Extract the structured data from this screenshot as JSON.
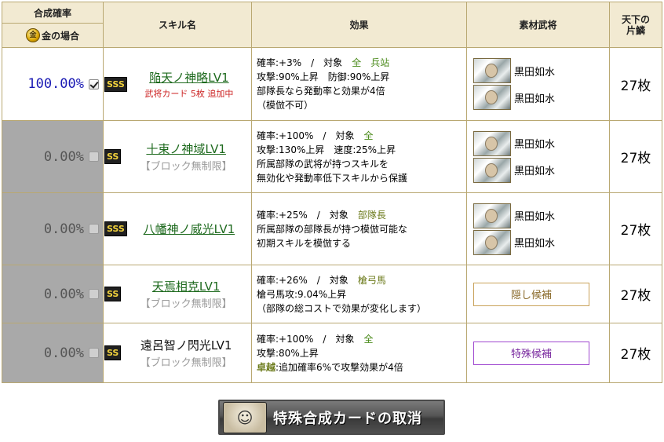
{
  "header": {
    "rate_title": "合成確率",
    "gold_label": "金の場合",
    "coin_icon_text": "金",
    "skill_name": "スキル名",
    "effect": "効果",
    "material": "素材武将",
    "tenka_line1": "天下の",
    "tenka_line2": "片鱗"
  },
  "rows": [
    {
      "rate": "100.00%",
      "checked": true,
      "rank": "SSS",
      "skill": "陥天ノ神略LV1",
      "sub": "武将カード 5枚 追加中",
      "effect": {
        "l1_prefix": "確率:+3%　/　対象　",
        "l1_target": "全　兵站",
        "l2": "攻撃:90%上昇　防御:90%上昇",
        "l3": "部隊長なら発動率と効果が4倍",
        "l4": "（模倣不可）"
      },
      "materials": [
        "黒田如水",
        "黒田如水"
      ],
      "tenka": "27枚"
    },
    {
      "rate": "0.00%",
      "checked": false,
      "rank": "SS",
      "skill": "十束ノ神域LV1",
      "sub": "【ブロック無制限】",
      "effect": {
        "l1_prefix": "確率:+100%　/　対象　",
        "l1_target": "全",
        "l2": "攻撃:130%上昇　速度:25%上昇",
        "l3": "所属部隊の武将が持つスキルを",
        "l4": "無効化や発動率低下スキルから保護"
      },
      "materials": [
        "黒田如水",
        "黒田如水"
      ],
      "tenka": "27枚"
    },
    {
      "rate": "0.00%",
      "checked": false,
      "rank": "SSS",
      "skill": "八幡神ノ威光LV1",
      "sub": "",
      "effect": {
        "l1_prefix": "確率:+25%　/　対象　",
        "l1_target": "部隊長",
        "l2": "所属部隊の部隊長が持つ模倣可能な",
        "l3": "初期スキルを模倣する"
      },
      "materials": [
        "黒田如水",
        "黒田如水"
      ],
      "tenka": "27枚"
    },
    {
      "rate": "0.00%",
      "checked": false,
      "rank": "SS",
      "skill": "天焉相克LV1",
      "sub": "【ブロック無制限】",
      "effect": {
        "l1_prefix": "確率:+26%　/　対象　",
        "l1_target": "槍弓馬",
        "l2": "槍弓馬攻:9.04%上昇",
        "l3": "（部隊の総コストで効果が変化します）"
      },
      "candidate": "隠し候補",
      "tenka": "27枚"
    },
    {
      "rate": "0.00%",
      "checked": false,
      "rank": "SS",
      "skill": "遠呂智ノ閃光LV1",
      "sub": "【ブロック無制限】",
      "effect": {
        "l1_prefix": "確率:+100%　/　対象　",
        "l1_target": "全",
        "l2": "攻撃:80%上昇",
        "l3_label": "卓越",
        "l3": ":追加確率6%で攻撃効果が4倍"
      },
      "candidate": "特殊候補",
      "tenka": "27枚"
    }
  ],
  "cancel_button": "特殊合成カードの取消",
  "colors": {
    "rate_on": "#1a1ab4",
    "gray_cell": "#a9a9a9",
    "border": "#b9a872",
    "header_bg": "#f2ead2",
    "skill_link": "#1e6a1e"
  }
}
